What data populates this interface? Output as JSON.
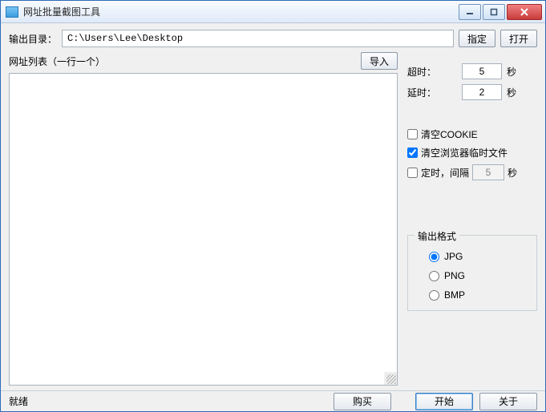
{
  "window": {
    "title": "网址批量截图工具"
  },
  "output": {
    "label": "输出目录：",
    "path": "C:\\Users\\Lee\\Desktop",
    "select_btn": "指定",
    "open_btn": "打开"
  },
  "urllist": {
    "label": "网址列表（一行一个）",
    "import_btn": "导入"
  },
  "settings": {
    "timeout_label": "超时：",
    "timeout_value": "5",
    "delay_label": "延时：",
    "delay_value": "2",
    "unit": "秒",
    "clear_cookie_label": "清空COOKIE",
    "clear_cookie_checked": false,
    "clear_temp_label": "清空浏览器临时文件",
    "clear_temp_checked": true,
    "interval_enable_label": "定时，间隔",
    "interval_checked": false,
    "interval_value": "5"
  },
  "format": {
    "legend": "输出格式",
    "options": [
      "JPG",
      "PNG",
      "BMP"
    ],
    "selected": "JPG"
  },
  "footer": {
    "status": "就绪",
    "buy": "购买",
    "start": "开始",
    "about": "关于"
  }
}
